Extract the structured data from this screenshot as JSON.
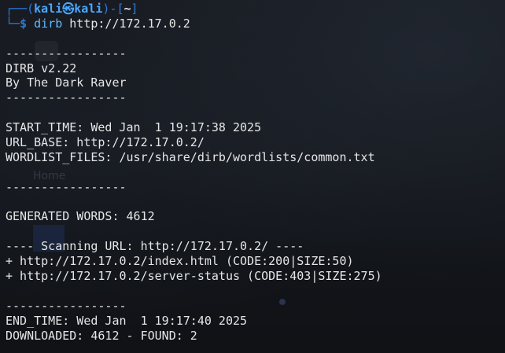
{
  "prompt": {
    "frame_top_left": "┌──(",
    "user": "kali",
    "skull": "㉿",
    "host": "kali",
    "frame_mid": ")-[",
    "cwd": "~",
    "frame_end": "]",
    "frame_bottom": "└─",
    "symbol": "$",
    "command": "dirb",
    "argument": "http://172.17.0.2"
  },
  "background": {
    "ghost_label": "Home"
  },
  "output_lines": [
    "",
    "-----------------",
    "DIRB v2.22",
    "By The Dark Raver",
    "-----------------",
    "",
    "START_TIME: Wed Jan  1 19:17:38 2025",
    "URL_BASE: http://172.17.0.2/",
    "WORDLIST_FILES: /usr/share/dirb/wordlists/common.txt",
    "",
    "-----------------",
    "",
    "GENERATED WORDS: 4612",
    "",
    "---- Scanning URL: http://172.17.0.2/ ----",
    "+ http://172.17.0.2/index.html (CODE:200|SIZE:50)",
    "+ http://172.17.0.2/server-status (CODE:403|SIZE:275)",
    "",
    "-----------------",
    "END_TIME: Wed Jan  1 19:17:40 2025",
    "DOWNLOADED: 4612 - FOUND: 2"
  ],
  "colors": {
    "background": "#0f1115",
    "frame": "#2f7ad6",
    "user": "#4aa8ff",
    "command": "#5fb8ff",
    "text": "#e6e6e6"
  }
}
